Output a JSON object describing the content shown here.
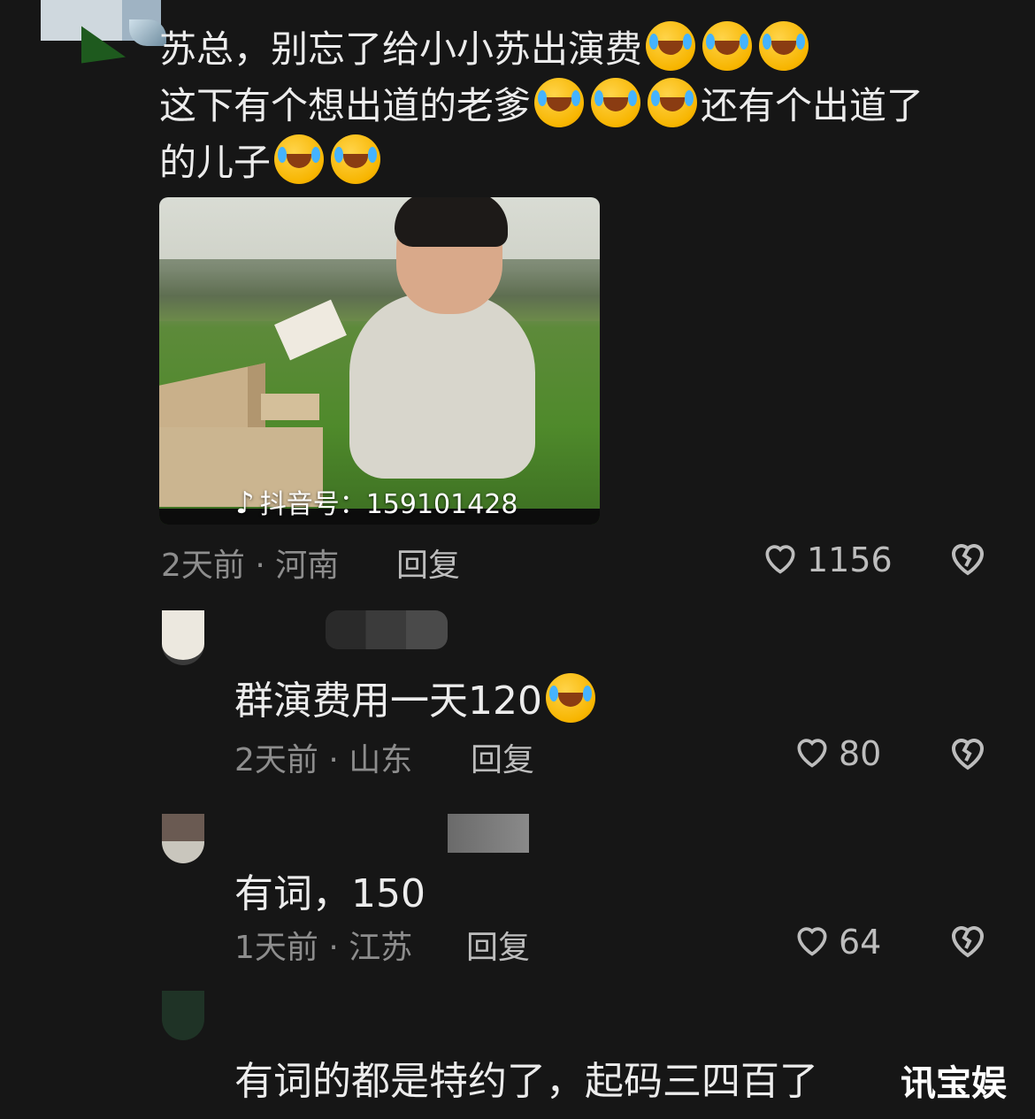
{
  "main_comment": {
    "lines": [
      "苏总，别忘了给小小苏出演费",
      "这下有个想出道的老爹",
      "还有个出道了",
      "的儿子"
    ],
    "video_watermark": "抖音号：159101428",
    "time_location": "2天前 · 河南",
    "reply_label": "回复",
    "likes": "1156"
  },
  "replies": [
    {
      "text": "群演费用一天120",
      "time_location": "2天前 · 山东",
      "reply_label": "回复",
      "likes": "80"
    },
    {
      "text": "有词，150",
      "time_location": "1天前 · 江苏",
      "reply_label": "回复",
      "likes": "64"
    },
    {
      "text": "有词的都是特约了，起码三四百了"
    }
  ],
  "site_watermark": "讯宝娱",
  "icons": [
    "laughing-crying-emoji",
    "heart-icon",
    "broken-heart-icon",
    "tiktok-icon"
  ]
}
